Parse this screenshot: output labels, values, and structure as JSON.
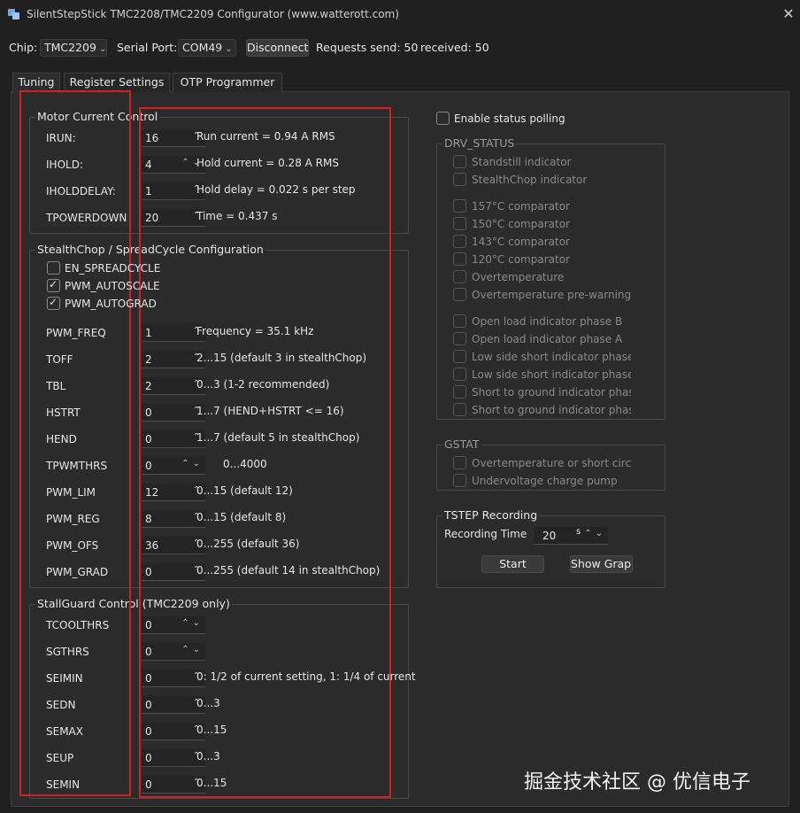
{
  "window": {
    "title": "SilentStepStick TMC2208/TMC2209 Configurator (www.watterott.com)",
    "close_glyph": "✕"
  },
  "toolbar": {
    "chip_label": "Chip:",
    "chip_value": "TMC2209",
    "port_label": "Serial Port:",
    "port_value": "COM49",
    "disconnect_label": "Disconnect",
    "requests_text": "Requests send: 50",
    "received_text": "received: 50"
  },
  "tabs": [
    {
      "label": "Tuning",
      "active": true
    },
    {
      "label": "Register Settings",
      "active": false
    },
    {
      "label": "OTP Programmer",
      "active": false
    }
  ],
  "motor_current": {
    "title": "Motor Current Control",
    "rows": [
      {
        "label": "IRUN:",
        "value": "16",
        "desc": "Run current = 0.94 A RMS"
      },
      {
        "label": "IHOLD:",
        "value": "4",
        "desc": "Hold current = 0.28 A RMS"
      },
      {
        "label": "IHOLDDELAY:",
        "value": "1",
        "desc": "Hold delay = 0.022 s per step"
      },
      {
        "label": "TPOWERDOWN",
        "value": "20",
        "desc": "Time = 0.437 s"
      }
    ]
  },
  "stealthchop": {
    "title": "StealthChop / SpreadCycle Configuration",
    "checks": [
      {
        "label": "EN_SPREADCYCLE",
        "checked": false
      },
      {
        "label": "PWM_AUTOSCALE",
        "checked": true
      },
      {
        "label": "PWM_AUTOGRAD",
        "checked": true
      }
    ],
    "rows": [
      {
        "label": "PWM_FREQ",
        "value": "1",
        "desc": "Frequency = 35.1 kHz"
      },
      {
        "label": "TOFF",
        "value": "2",
        "desc": "2...15 (default 3 in stealthChop)"
      },
      {
        "label": "TBL",
        "value": "2",
        "desc": "0...3 (1-2 recommended)"
      },
      {
        "label": "HSTRT",
        "value": "0",
        "desc": "1...7 (HEND+HSTRT <= 16)"
      },
      {
        "label": "HEND",
        "value": "0",
        "desc": "1...7 (default 5 in stealthChop)"
      },
      {
        "label": "TPWMTHRS",
        "value": "0",
        "desc": "0...4000"
      },
      {
        "label": "PWM_LIM",
        "value": "12",
        "desc": "0...15 (default 12)"
      },
      {
        "label": "PWM_REG",
        "value": "8",
        "desc": "0...15 (default 8)"
      },
      {
        "label": "PWM_OFS",
        "value": "36",
        "desc": "0...255 (default 36)"
      },
      {
        "label": "PWM_GRAD",
        "value": "0",
        "desc": "0...255 (default 14 in stealthChop)"
      }
    ]
  },
  "stallguard": {
    "title": "StallGuard Control (TMC2209 only)",
    "rows": [
      {
        "label": "TCOOLTHRS",
        "value": "0",
        "desc": ""
      },
      {
        "label": "SGTHRS",
        "value": "0",
        "desc": ""
      },
      {
        "label": "SEIMIN",
        "value": "0",
        "desc": "0: 1/2 of current setting, 1: 1/4 of current"
      },
      {
        "label": "SEDN",
        "value": "0",
        "desc": "0...3"
      },
      {
        "label": "SEMAX",
        "value": "0",
        "desc": "0...15"
      },
      {
        "label": "SEUP",
        "value": "0",
        "desc": "0...3"
      },
      {
        "label": "SEMIN",
        "value": "0",
        "desc": "0...15"
      }
    ]
  },
  "status_polling": {
    "label": "Enable status polling",
    "checked": false
  },
  "drv_status": {
    "title": "DRV_STATUS",
    "items": [
      "Standstill indicator",
      "StealthChop indicator",
      "157°C comparator",
      "150°C comparator",
      "143°C comparator",
      "120°C comparator",
      "Overtemperature",
      "Overtemperature pre-warning",
      "Open load indicator phase B",
      "Open load indicator phase A",
      "Low side short indicator phase",
      "Low side short indicator phase",
      "Short to ground indicator phas",
      "Short to ground indicator phas"
    ]
  },
  "gstat": {
    "title": "GSTAT",
    "items": [
      "Overtemperature or short circu",
      "Undervoltage charge pump"
    ]
  },
  "tstep": {
    "title": "TSTEP Recording",
    "time_label": "Recording Time",
    "time_value": "20",
    "time_unit": "s",
    "start_label": "Start",
    "graph_label": "Show Graph"
  },
  "watermark": "掘金技术社区 @ 优信电子",
  "colors": {
    "highlight_box": "#d21f26",
    "background": "#2b2b2b"
  }
}
